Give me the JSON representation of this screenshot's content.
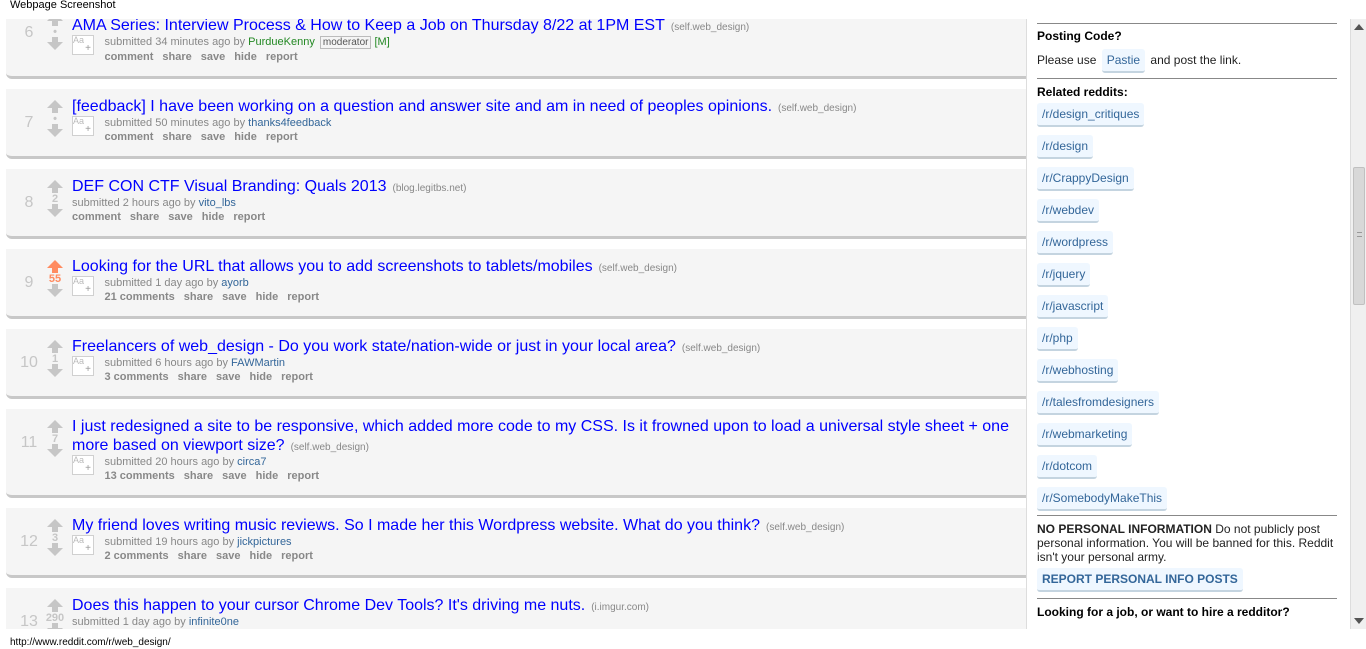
{
  "window": {
    "title": "Webpage Screenshot"
  },
  "status_url": "http://www.reddit.com/r/web_design/",
  "posts": [
    {
      "rank": "6",
      "score": "•",
      "title": "AMA Series: Interview Process & How to Keep a Job on Thursday 8/22 at 1PM EST",
      "domain": "(self.web_design)",
      "submitted": "submitted 34 minutes ago by",
      "author": "PurdueKenny",
      "badge": "moderator",
      "mtag": "[M]",
      "comments": "comment",
      "share": "share",
      "save": "save",
      "hide": "hide",
      "report": "report"
    },
    {
      "rank": "7",
      "score": "•",
      "title": "[feedback] I have been working on a question and answer site and am in need of peoples opinions.",
      "domain": "(self.web_design)",
      "submitted": "submitted 50 minutes ago by",
      "author": "thanks4feedback",
      "comments": "comment",
      "share": "share",
      "save": "save",
      "hide": "hide",
      "report": "report"
    },
    {
      "rank": "8",
      "score": "2",
      "title": "DEF CON CTF Visual Branding: Quals 2013",
      "domain": "(blog.legitbs.net)",
      "submitted": "submitted 2 hours ago by",
      "author": "vito_lbs",
      "comments": "comment",
      "share": "share",
      "save": "save",
      "hide": "hide",
      "report": "report"
    },
    {
      "rank": "9",
      "score": "55",
      "title": "Looking for the URL that allows you to add screenshots to tablets/mobiles",
      "domain": "(self.web_design)",
      "submitted": "submitted 1 day ago by",
      "author": "ayorb",
      "comments": "21 comments",
      "share": "share",
      "save": "save",
      "hide": "hide",
      "report": "report"
    },
    {
      "rank": "10",
      "score": "1",
      "title": "Freelancers of web_design - Do you work state/nation-wide or just in your local area?",
      "domain": "(self.web_design)",
      "submitted": "submitted 6 hours ago by",
      "author": "FAWMartin",
      "comments": "3 comments",
      "share": "share",
      "save": "save",
      "hide": "hide",
      "report": "report"
    },
    {
      "rank": "11",
      "score": "7",
      "title": "I just redesigned a site to be responsive, which added more code to my CSS. Is it frowned upon to load a universal style sheet + one more based on viewport size?",
      "domain": "(self.web_design)",
      "submitted": "submitted 20 hours ago by",
      "author": "circa7",
      "comments": "13 comments",
      "share": "share",
      "save": "save",
      "hide": "hide",
      "report": "report"
    },
    {
      "rank": "12",
      "score": "3",
      "title": "My friend loves writing music reviews. So I made her this Wordpress website. What do you think?",
      "domain": "(self.web_design)",
      "submitted": "submitted 19 hours ago by",
      "author": "jickpictures",
      "comments": "2 comments",
      "share": "share",
      "save": "save",
      "hide": "hide",
      "report": "report"
    },
    {
      "rank": "13",
      "score": "290",
      "title": "Does this happen to your cursor Chrome Dev Tools? It's driving me nuts.",
      "domain": "(i.imgur.com)",
      "submitted": "submitted 1 day ago by",
      "author": "infinite0ne"
    }
  ],
  "aa_label": "Aa",
  "aa_plus": "+",
  "sidebar": {
    "posting_code_heading": "Posting Code?",
    "please_use": "Please use",
    "pastie": "Pastie",
    "post_link": "and post the link.",
    "related_heading": "Related reddits:",
    "related": [
      "/r/design_critiques",
      "/r/design",
      "/r/CrappyDesign",
      "/r/webdev",
      "/r/wordpress",
      "/r/jquery",
      "/r/javascript",
      "/r/php",
      "/r/webhosting",
      "/r/talesfromdesigners",
      "/r/webmarketing",
      "/r/dotcom",
      "/r/SomebodyMakeThis"
    ],
    "no_personal_bold": "NO PERSONAL INFORMATION",
    "no_personal_text": "Do not publicly post personal information. You will be banned for this. Reddit isn't your personal army.",
    "report_button": "REPORT PERSONAL INFO POSTS",
    "job_heading": "Looking for a job, or want to hire a redditor?"
  },
  "colors": {
    "link": "#0000ff",
    "upvoted": "#ff8b60",
    "author": "#336699"
  }
}
